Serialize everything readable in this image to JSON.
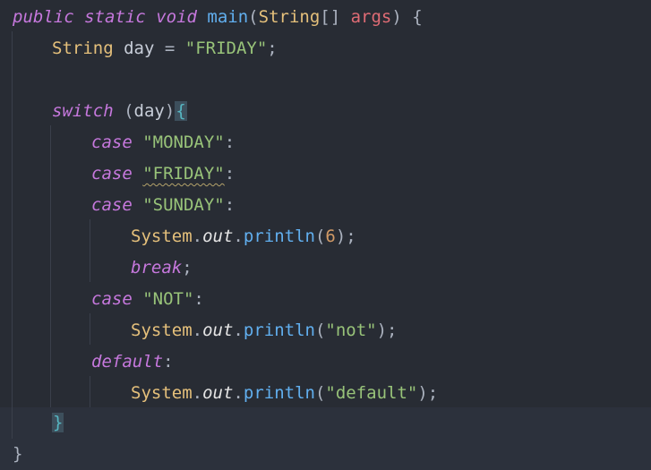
{
  "editor": {
    "lines": [
      {
        "indent": 0,
        "tokens": [
          {
            "t": "public",
            "c": "kw"
          },
          {
            "t": " ",
            "c": "punct"
          },
          {
            "t": "static",
            "c": "kw"
          },
          {
            "t": " ",
            "c": "punct"
          },
          {
            "t": "void",
            "c": "kw"
          },
          {
            "t": " ",
            "c": "punct"
          },
          {
            "t": "main",
            "c": "fn"
          },
          {
            "t": "(",
            "c": "punct"
          },
          {
            "t": "String",
            "c": "type"
          },
          {
            "t": "[] ",
            "c": "punct"
          },
          {
            "t": "args",
            "c": "param"
          },
          {
            "t": ") {",
            "c": "punct"
          }
        ]
      },
      {
        "indent": 1,
        "tokens": [
          {
            "t": "String",
            "c": "type"
          },
          {
            "t": " ",
            "c": "punct"
          },
          {
            "t": "day",
            "c": "var"
          },
          {
            "t": " = ",
            "c": "punct"
          },
          {
            "t": "\"FRIDAY\"",
            "c": "str"
          },
          {
            "t": ";",
            "c": "punct"
          }
        ]
      },
      {
        "indent": 0,
        "tokens": []
      },
      {
        "indent": 1,
        "tokens": [
          {
            "t": "switch",
            "c": "kw"
          },
          {
            "t": " (",
            "c": "punct"
          },
          {
            "t": "day",
            "c": "var"
          },
          {
            "t": ")",
            "c": "punct"
          },
          {
            "t": "{",
            "c": "brace-hl"
          }
        ]
      },
      {
        "indent": 2,
        "tokens": [
          {
            "t": "case",
            "c": "kw"
          },
          {
            "t": " ",
            "c": "punct"
          },
          {
            "t": "\"MONDAY\"",
            "c": "str"
          },
          {
            "t": ":",
            "c": "punct"
          }
        ]
      },
      {
        "indent": 2,
        "tokens": [
          {
            "t": "case",
            "c": "kw"
          },
          {
            "t": " ",
            "c": "punct"
          },
          {
            "t": "\"FRIDAY\"",
            "c": "str wavy"
          },
          {
            "t": ":",
            "c": "punct"
          }
        ]
      },
      {
        "indent": 2,
        "tokens": [
          {
            "t": "case",
            "c": "kw"
          },
          {
            "t": " ",
            "c": "punct"
          },
          {
            "t": "\"SUNDAY\"",
            "c": "str"
          },
          {
            "t": ":",
            "c": "punct"
          }
        ]
      },
      {
        "indent": 3,
        "tokens": [
          {
            "t": "System",
            "c": "type"
          },
          {
            "t": ".",
            "c": "punct"
          },
          {
            "t": "out",
            "c": "field"
          },
          {
            "t": ".",
            "c": "punct"
          },
          {
            "t": "println",
            "c": "fn"
          },
          {
            "t": "(",
            "c": "punct"
          },
          {
            "t": "6",
            "c": "num"
          },
          {
            "t": ");",
            "c": "punct"
          }
        ]
      },
      {
        "indent": 3,
        "tokens": [
          {
            "t": "break",
            "c": "kw"
          },
          {
            "t": ";",
            "c": "punct"
          }
        ]
      },
      {
        "indent": 2,
        "tokens": [
          {
            "t": "case",
            "c": "kw"
          },
          {
            "t": " ",
            "c": "punct"
          },
          {
            "t": "\"NOT\"",
            "c": "str"
          },
          {
            "t": ":",
            "c": "punct"
          }
        ]
      },
      {
        "indent": 3,
        "tokens": [
          {
            "t": "System",
            "c": "type"
          },
          {
            "t": ".",
            "c": "punct"
          },
          {
            "t": "out",
            "c": "field"
          },
          {
            "t": ".",
            "c": "punct"
          },
          {
            "t": "println",
            "c": "fn"
          },
          {
            "t": "(",
            "c": "punct"
          },
          {
            "t": "\"not\"",
            "c": "str"
          },
          {
            "t": ");",
            "c": "punct"
          }
        ]
      },
      {
        "indent": 2,
        "tokens": [
          {
            "t": "default",
            "c": "kw"
          },
          {
            "t": ":",
            "c": "punct"
          }
        ]
      },
      {
        "indent": 3,
        "tokens": [
          {
            "t": "System",
            "c": "type"
          },
          {
            "t": ".",
            "c": "punct"
          },
          {
            "t": "out",
            "c": "field"
          },
          {
            "t": ".",
            "c": "punct"
          },
          {
            "t": "println",
            "c": "fn"
          },
          {
            "t": "(",
            "c": "punct"
          },
          {
            "t": "\"default\"",
            "c": "str"
          },
          {
            "t": ");",
            "c": "punct"
          }
        ]
      },
      {
        "indent": 1,
        "current": true,
        "tokens": [
          {
            "t": "}",
            "c": "brace-hl"
          }
        ]
      },
      {
        "indent": 0,
        "current": true,
        "tokens": [
          {
            "t": "}",
            "c": "punct"
          }
        ]
      }
    ]
  },
  "colors": {
    "background": "#282c34",
    "current_line": "#2c313c",
    "keyword": "#c678dd",
    "type": "#e5c07b",
    "function": "#61afef",
    "string": "#98c379",
    "number": "#d19a66",
    "brace_match": "#56b6c2"
  }
}
